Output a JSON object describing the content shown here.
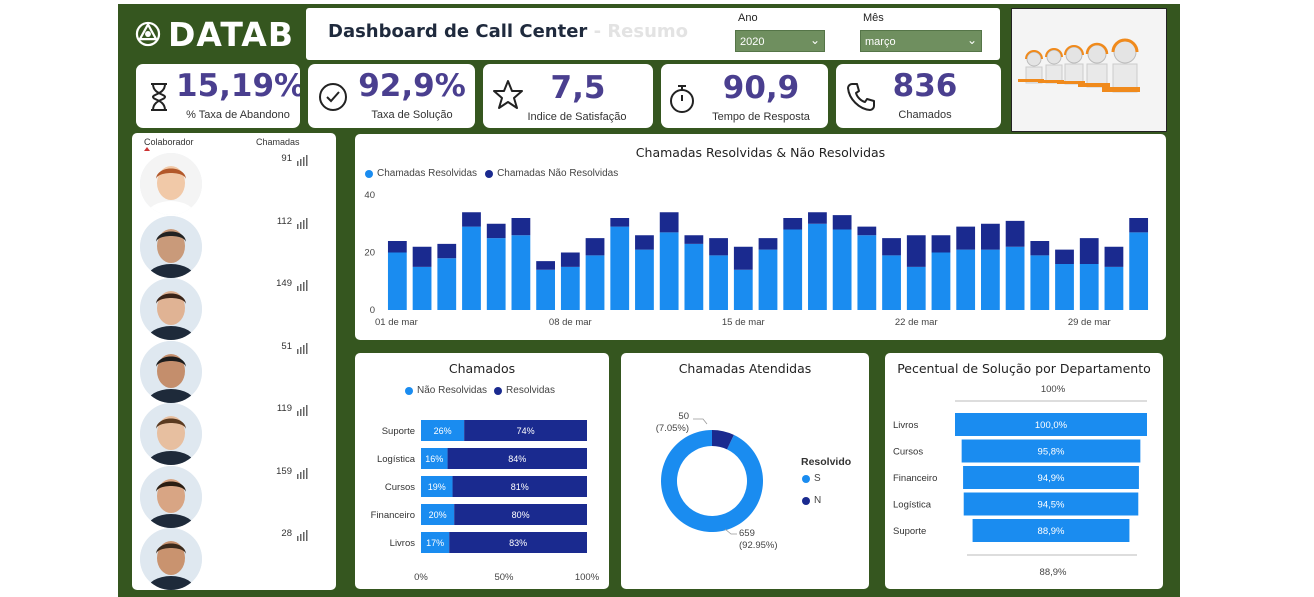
{
  "header": {
    "logo_text": "DATAB",
    "title": "Dashboard de Call Center",
    "subtitle": "- Resumo",
    "filters": [
      {
        "label": "Ano",
        "value": "2020"
      },
      {
        "label": "Mês",
        "value": "março"
      }
    ]
  },
  "kpis": [
    {
      "value": "15,19%",
      "label": "% Taxa de Abandono",
      "icon": "hourglass-icon"
    },
    {
      "value": "92,9%",
      "label": "Taxa de Solução",
      "icon": "check-circle-icon"
    },
    {
      "value": "7,5",
      "label": "Indice de Satisfação",
      "icon": "star-icon"
    },
    {
      "value": "90,9",
      "label": "Tempo de Resposta",
      "icon": "stopwatch-icon"
    },
    {
      "value": "836",
      "label": "Chamados",
      "icon": "phone-icon"
    }
  ],
  "collaborators": {
    "col_name": "Colaborador",
    "col_calls": "Chamadas",
    "rows": [
      {
        "calls": "91"
      },
      {
        "calls": "112"
      },
      {
        "calls": "149"
      },
      {
        "calls": "51"
      },
      {
        "calls": "119"
      },
      {
        "calls": "159"
      },
      {
        "calls": "28"
      }
    ]
  },
  "colors": {
    "resolved": "#1a8cf0",
    "unresolved": "#1a2a8f",
    "kpi_text": "#4a3f8f",
    "background": "#35561f"
  },
  "chart_data": [
    {
      "type": "bar",
      "stacked": true,
      "title": "Chamadas Resolvidas & Não Resolvidas",
      "legend": [
        "Chamadas Resolvidas",
        "Chamadas Não Resolvidas"
      ],
      "ylim": [
        0,
        40
      ],
      "yticks": [
        0,
        20,
        40
      ],
      "xtick_labels": [
        "01 de mar",
        "08 de mar",
        "15 de mar",
        "22 de mar",
        "29 de mar"
      ],
      "xtick_index": [
        0,
        7,
        14,
        21,
        28
      ],
      "categories": [
        "1",
        "2",
        "3",
        "4",
        "5",
        "6",
        "7",
        "8",
        "9",
        "10",
        "11",
        "12",
        "13",
        "14",
        "15",
        "16",
        "17",
        "18",
        "19",
        "20",
        "21",
        "22",
        "23",
        "24",
        "25",
        "26",
        "27",
        "28",
        "29",
        "30",
        "31"
      ],
      "series": [
        {
          "name": "Chamadas Resolvidas",
          "values": [
            20,
            15,
            18,
            29,
            25,
            26,
            14,
            15,
            19,
            29,
            21,
            27,
            23,
            19,
            14,
            21,
            28,
            30,
            28,
            26,
            19,
            15,
            20,
            21,
            21,
            22,
            19,
            16,
            16,
            15,
            27
          ]
        },
        {
          "name": "Chamadas Não Resolvidas",
          "values": [
            4,
            7,
            5,
            5,
            5,
            6,
            3,
            5,
            6,
            3,
            5,
            7,
            3,
            6,
            8,
            4,
            4,
            4,
            5,
            3,
            6,
            11,
            6,
            8,
            9,
            9,
            5,
            5,
            9,
            7,
            5
          ]
        }
      ]
    },
    {
      "type": "bar",
      "orientation": "horizontal",
      "stacked": "percent",
      "title": "Chamados",
      "legend": [
        "Não Resolvidas",
        "Resolvidas"
      ],
      "categories": [
        "Suporte",
        "Logística",
        "Cursos",
        "Financeiro",
        "Livros"
      ],
      "series": [
        {
          "name": "Não Resolvidas",
          "values": [
            26,
            16,
            19,
            20,
            17
          ]
        },
        {
          "name": "Resolvidas",
          "values": [
            74,
            84,
            81,
            80,
            83
          ]
        }
      ],
      "xticks": [
        "0%",
        "50%",
        "100%"
      ]
    },
    {
      "type": "pie",
      "donut": true,
      "title": "Chamadas Atendidas",
      "legend_title": "Resolvido",
      "slices": [
        {
          "label": "S",
          "value": 659,
          "text": "659",
          "pct": "(92.95%)"
        },
        {
          "label": "N",
          "value": 50,
          "text": "50",
          "pct": "(7.05%)"
        }
      ]
    },
    {
      "type": "bar",
      "subtype": "funnel",
      "title": "Pecentual de Solução por Departamento",
      "top_label": "100%",
      "bottom_label": "88,9%",
      "categories": [
        "Livros",
        "Cursos",
        "Financeiro",
        "Logística",
        "Suporte"
      ],
      "values": [
        100.0,
        95.8,
        94.9,
        94.5,
        88.9
      ],
      "value_labels": [
        "100,0%",
        "95,8%",
        "94,9%",
        "94,5%",
        "88,9%"
      ]
    }
  ]
}
